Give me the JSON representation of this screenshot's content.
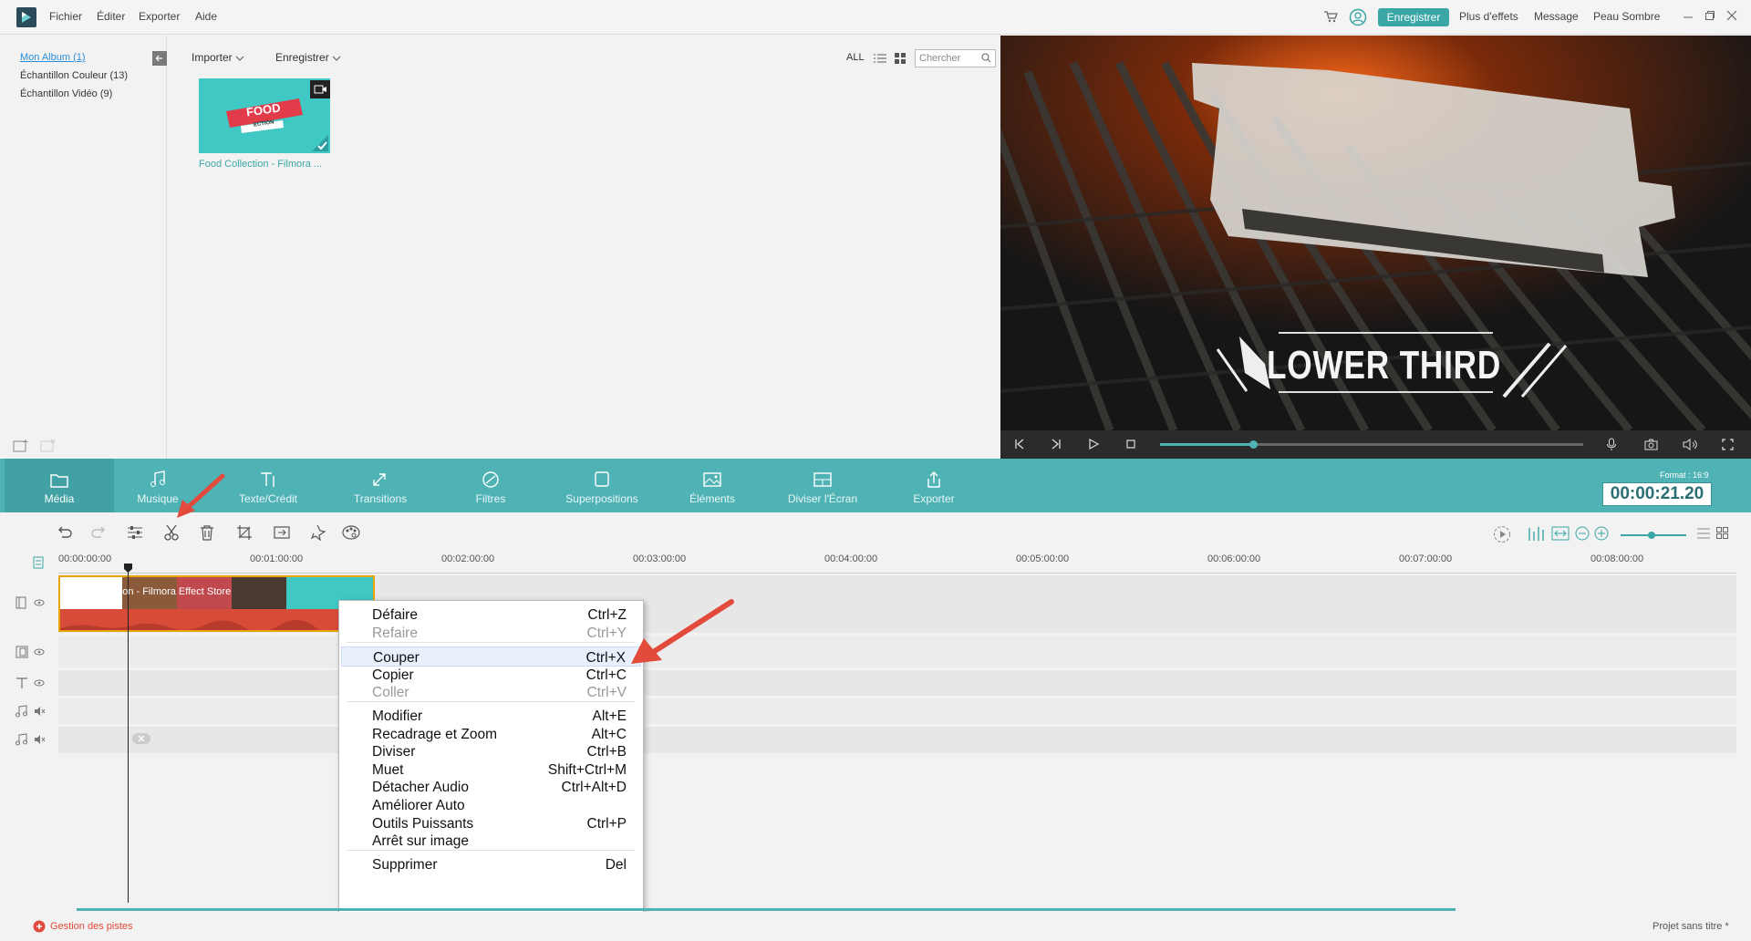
{
  "menu": {
    "items": [
      "Fichier",
      "Éditer",
      "Exporter",
      "Aide"
    ]
  },
  "topright": {
    "register": "Enregistrer",
    "more_effects": "Plus d'effets",
    "message": "Message",
    "skin": "Peau Sombre"
  },
  "albums": [
    "Mon Album (1)",
    "Échantillon Couleur (13)",
    "Échantillon Vidéo (9)"
  ],
  "library": {
    "import": "Importer",
    "record": "Enregistrer",
    "all": "ALL",
    "search_placeholder": "Chercher",
    "thumb_label": "Food Collection - Filmora ...",
    "thumb_title": "FOOD",
    "thumb_sub": "ECTION"
  },
  "preview": {
    "caption": "LOWER THIRD",
    "progress": 0.22
  },
  "tabs": [
    "Média",
    "Musique",
    "Texte/Crédit",
    "Transitions",
    "Filtres",
    "Superpositions",
    "Éléments",
    "Diviser l'Écran",
    "Exporter"
  ],
  "format": "Format : 16:9",
  "timecode": "00:00:21.20",
  "ruler": [
    "00:00:00:00",
    "00:01:00:00",
    "00:02:00:00",
    "00:03:00:00",
    "00:04:00:00",
    "00:05:00:00",
    "00:06:00:00",
    "00:07:00:00",
    "00:08:00:00"
  ],
  "clip": {
    "title": "Food Collection - Filmora Effect Store"
  },
  "context_menu": {
    "items": [
      {
        "label": "Défaire",
        "shortcut": "Ctrl+Z",
        "disabled": false
      },
      {
        "label": "Refaire",
        "shortcut": "Ctrl+Y",
        "disabled": true
      },
      {
        "label": "Couper",
        "shortcut": "Ctrl+X",
        "disabled": false,
        "highlighted": true
      },
      {
        "label": "Copier",
        "shortcut": "Ctrl+C",
        "disabled": false
      },
      {
        "label": "Coller",
        "shortcut": "Ctrl+V",
        "disabled": true
      },
      {
        "label": "Modifier",
        "shortcut": "Alt+E",
        "disabled": false
      },
      {
        "label": "Recadrage et Zoom",
        "shortcut": "Alt+C",
        "disabled": false
      },
      {
        "label": "Diviser",
        "shortcut": "Ctrl+B",
        "disabled": false
      },
      {
        "label": "Muet",
        "shortcut": "Shift+Ctrl+M",
        "disabled": false
      },
      {
        "label": "Détacher Audio",
        "shortcut": "Ctrl+Alt+D",
        "disabled": false
      },
      {
        "label": "Améliorer Auto",
        "shortcut": "",
        "disabled": false
      },
      {
        "label": "Outils Puissants",
        "shortcut": "Ctrl+P",
        "disabled": false
      },
      {
        "label": "Arrêt sur image",
        "shortcut": "",
        "disabled": false
      },
      {
        "label": "Supprimer",
        "shortcut": "Del",
        "disabled": false
      }
    ]
  },
  "bottom": {
    "manage_tracks": "Gestion des pistes",
    "project": "Projet sans titre *"
  },
  "colors": {
    "teal": "#4fb2b5",
    "accent": "#3aa6a6",
    "clip_red": "#d94b39",
    "arrow": "#e24a3b"
  }
}
